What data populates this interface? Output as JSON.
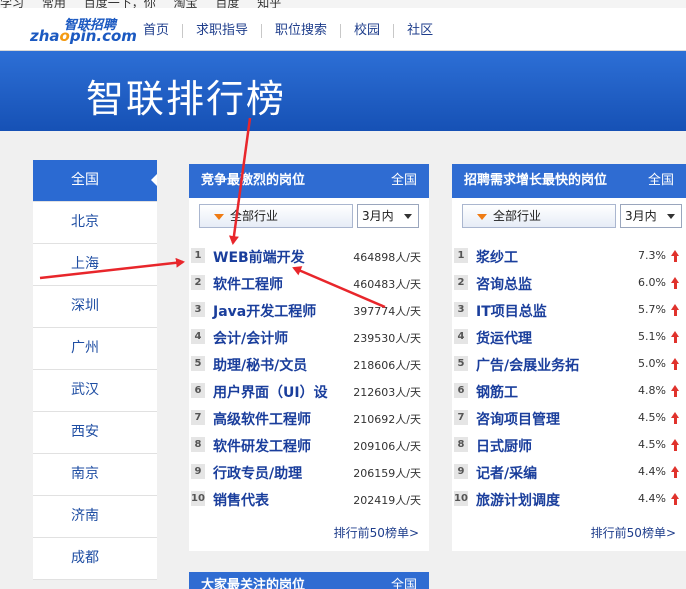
{
  "bookmarks": [
    "学习",
    "常用",
    "百度一下，你",
    "淘宝",
    "百度",
    "知乎"
  ],
  "nav": {
    "logo_cn": "智联招聘",
    "logo_en_a": "zha",
    "logo_en_b": "o",
    "logo_en_c": "pin.com",
    "links": [
      "首页",
      "求职指导",
      "职位搜索",
      "校园",
      "社区"
    ]
  },
  "banner_title": "智联排行榜",
  "cities": [
    "全国",
    "北京",
    "上海",
    "深圳",
    "广州",
    "武汉",
    "西安",
    "南京",
    "济南",
    "成都"
  ],
  "left_panel": {
    "title": "竞争最激烈的岗位",
    "scope": "全国",
    "industry": "全部行业",
    "period": "3月内",
    "rows": [
      {
        "rank": "1",
        "name": "WEB前端开发",
        "count": "464898人/天"
      },
      {
        "rank": "2",
        "name": "软件工程师",
        "count": "460483人/天"
      },
      {
        "rank": "3",
        "name": "Java开发工程师",
        "count": "397774人/天"
      },
      {
        "rank": "4",
        "name": "会计/会计师",
        "count": "239530人/天"
      },
      {
        "rank": "5",
        "name": "助理/秘书/文员",
        "count": "218606人/天"
      },
      {
        "rank": "6",
        "name": "用户界面（UI）设",
        "count": "212603人/天"
      },
      {
        "rank": "7",
        "name": "高级软件工程师",
        "count": "210692人/天"
      },
      {
        "rank": "8",
        "name": "软件研发工程师",
        "count": "209106人/天"
      },
      {
        "rank": "9",
        "name": "行政专员/助理",
        "count": "206159人/天"
      },
      {
        "rank": "10",
        "name": "销售代表",
        "count": "202419人/天"
      }
    ],
    "more": "排行前50榜单>"
  },
  "right_panel": {
    "title": "招聘需求增长最快的岗位",
    "scope": "全国",
    "industry": "全部行业",
    "period": "3月内",
    "rows": [
      {
        "rank": "1",
        "name": "浆纱工",
        "pct": "7.3%"
      },
      {
        "rank": "2",
        "name": "咨询总监",
        "pct": "6.0%"
      },
      {
        "rank": "3",
        "name": "IT项目总监",
        "pct": "5.7%"
      },
      {
        "rank": "4",
        "name": "货运代理",
        "pct": "5.1%"
      },
      {
        "rank": "5",
        "name": "广告/会展业务拓",
        "pct": "5.0%"
      },
      {
        "rank": "6",
        "name": "钢筋工",
        "pct": "4.8%"
      },
      {
        "rank": "7",
        "name": "咨询项目管理",
        "pct": "4.5%"
      },
      {
        "rank": "8",
        "name": "日式厨师",
        "pct": "4.5%"
      },
      {
        "rank": "9",
        "name": "记者/采编",
        "pct": "4.4%"
      },
      {
        "rank": "10",
        "name": "旅游计划调度",
        "pct": "4.4%"
      }
    ],
    "more": "排行前50榜单>"
  },
  "bottom_panel": {
    "title": "大家最关注的岗位",
    "scope": "全国"
  },
  "colors": {
    "brand_blue": "#2f6cd2",
    "annotation_red": "#e8262b",
    "up_arrow": "#e0322c"
  }
}
